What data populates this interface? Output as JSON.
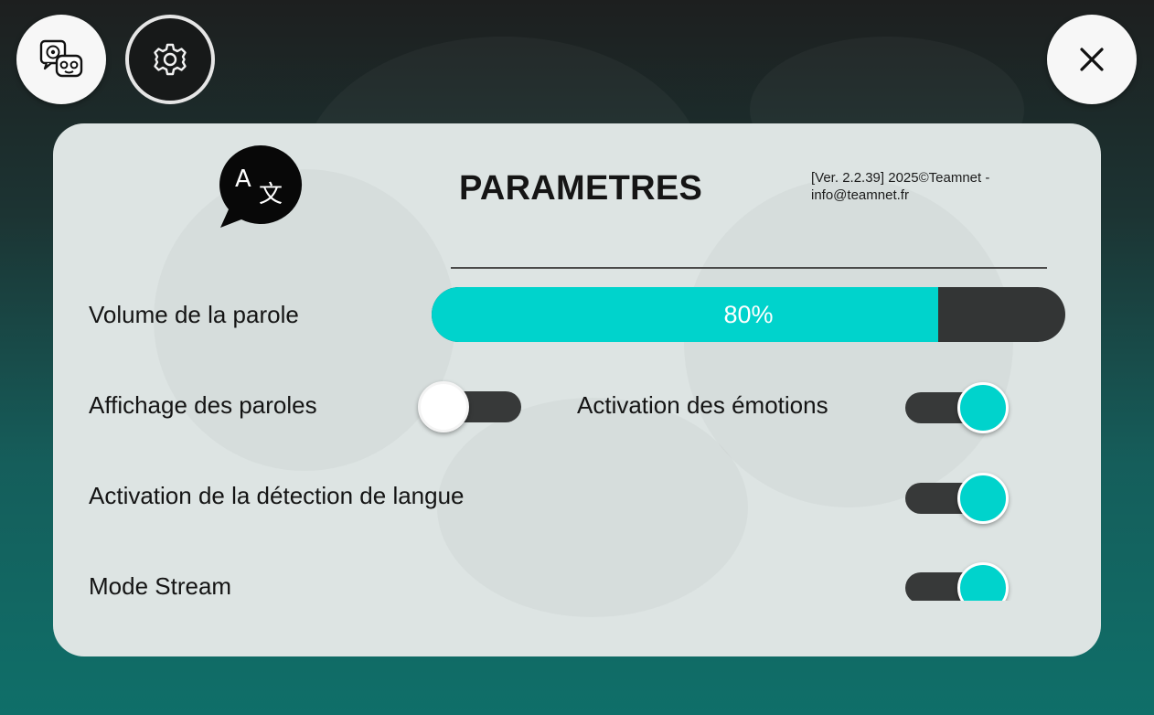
{
  "header": {
    "chat_button_icon": "chat-robot-icon",
    "settings_button_icon": "gear-icon",
    "close_button_icon": "close-icon"
  },
  "panel": {
    "icon": "language-translate-icon",
    "title": "PARAMETRES",
    "version_line1": "[Ver. 2.2.39] 2025©Teamnet -",
    "version_line2": "info@teamnet.fr"
  },
  "settings": {
    "volume": {
      "label": "Volume de la parole",
      "value_text": "80%",
      "value_percent": 80
    },
    "speech_display": {
      "label": "Affichage des paroles",
      "enabled": false
    },
    "emotions": {
      "label": "Activation des émotions",
      "enabled": true
    },
    "language_detection": {
      "label": "Activation de la détection de langue",
      "enabled": true
    },
    "stream_mode": {
      "label": "Mode Stream",
      "enabled": true
    }
  },
  "colors": {
    "accent": "#00d3cc",
    "track": "#373939",
    "panel_bg": "#dde4e3"
  }
}
